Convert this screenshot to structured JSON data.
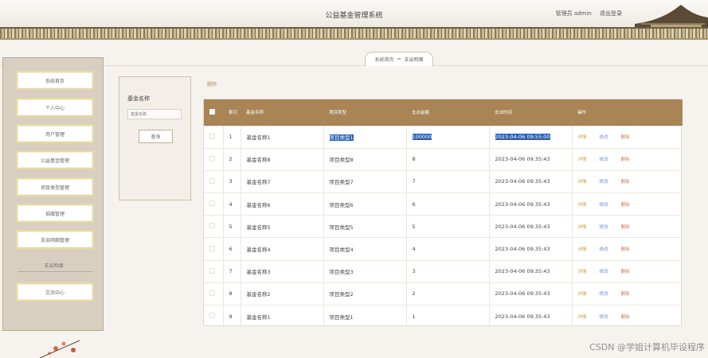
{
  "header": {
    "title": "公益基金管理系统",
    "user": "管理员 admin",
    "logout": "退出登录"
  },
  "breadcrumb": {
    "home": "系统首页",
    "separator": "=",
    "current": "支出明细"
  },
  "sidebar": {
    "items": [
      {
        "label": "系统首页"
      },
      {
        "label": "个人中心"
      },
      {
        "label": "用户管理"
      },
      {
        "label": "公益基金管理"
      },
      {
        "label": "项目类型管理"
      },
      {
        "label": "捐赠管理"
      },
      {
        "label": "支出明细管理"
      }
    ],
    "group_label": "支出明细",
    "extra_item": "交流中心"
  },
  "search": {
    "label": "基金名称",
    "placeholder": "基金名称",
    "button": "查询"
  },
  "toolbar": {
    "delete": "删除"
  },
  "table": {
    "headers": [
      "",
      "索引",
      "基金名称",
      "项目类型",
      "支出金额",
      "支出时间",
      "操作"
    ],
    "actions": {
      "detail": "详情",
      "edit": "修改",
      "delete": "删除"
    },
    "rows": [
      {
        "index": "1",
        "name": "基金名称1",
        "type": "项目类型1",
        "amount": "100000",
        "time": "2023-04-06 09:55:00"
      },
      {
        "index": "2",
        "name": "基金名称8",
        "type": "项目类型8",
        "amount": "8",
        "time": "2023-04-06 09:35:43"
      },
      {
        "index": "3",
        "name": "基金名称7",
        "type": "项目类型7",
        "amount": "7",
        "time": "2023-04-06 09:35:43"
      },
      {
        "index": "4",
        "name": "基金名称6",
        "type": "项目类型6",
        "amount": "6",
        "time": "2023-04-06 09:35:43"
      },
      {
        "index": "5",
        "name": "基金名称5",
        "type": "项目类型5",
        "amount": "5",
        "time": "2023-04-06 09:35:43"
      },
      {
        "index": "6",
        "name": "基金名称4",
        "type": "项目类型4",
        "amount": "4",
        "time": "2023-04-06 09:35:43"
      },
      {
        "index": "7",
        "name": "基金名称3",
        "type": "项目类型3",
        "amount": "3",
        "time": "2023-04-06 09:35:43"
      },
      {
        "index": "8",
        "name": "基金名称2",
        "type": "项目类型2",
        "amount": "2",
        "time": "2023-04-06 09:35:43"
      },
      {
        "index": "9",
        "name": "基金名称1",
        "type": "项目类型1",
        "amount": "1",
        "time": "2023-04-06 09:35:43"
      }
    ]
  },
  "watermark": "CSDN @学姐计算机毕设程序",
  "colors": {
    "accent": "#a98455",
    "sidebar_bg": "#d9cfc0",
    "selection": "#2a5fb0"
  }
}
